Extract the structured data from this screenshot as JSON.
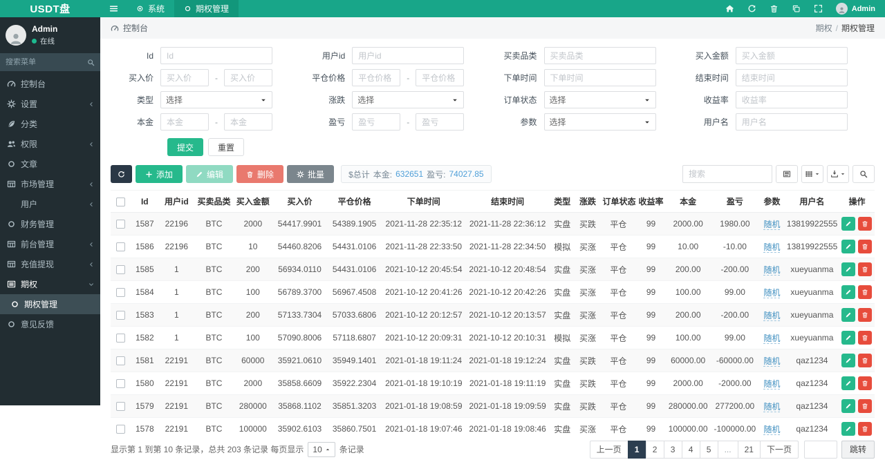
{
  "colors": {
    "accent_green": "#18a689",
    "success_text": "#1db98f",
    "link_blue": "#3f8fc0",
    "danger_red": "#e74c3c",
    "sidebar_bg": "#222d32",
    "pagination_active": "#2c3e50"
  },
  "app": {
    "logo": "USDT盘"
  },
  "topbar": {
    "tabs": [
      {
        "label": "系统"
      },
      {
        "label": "期权管理",
        "active": true
      }
    ],
    "user": "Admin"
  },
  "sidebar": {
    "user": {
      "name": "Admin",
      "status": "在线"
    },
    "search_placeholder": "搜索菜单",
    "items": [
      {
        "id": "dashboard",
        "label": "控制台",
        "icon": "gauge"
      },
      {
        "id": "settings",
        "label": "设置",
        "icon": "gear",
        "arrow": "left"
      },
      {
        "id": "category",
        "label": "分类",
        "icon": "leaf"
      },
      {
        "id": "permission",
        "label": "权限",
        "icon": "users",
        "arrow": "left"
      },
      {
        "id": "article",
        "label": "文章",
        "icon": "circle"
      },
      {
        "id": "market",
        "label": "市场管理",
        "icon": "table",
        "arrow": "left"
      },
      {
        "id": "user",
        "label": "用户",
        "icon": "user",
        "arrow": "left"
      },
      {
        "id": "finance",
        "label": "财务管理",
        "icon": "circle"
      },
      {
        "id": "frontend",
        "label": "前台管理",
        "icon": "table",
        "arrow": "left"
      },
      {
        "id": "recharge",
        "label": "充值提现",
        "icon": "table",
        "arrow": "left"
      },
      {
        "id": "option",
        "label": "期权",
        "icon": "list",
        "arrow": "down",
        "expanded": true
      },
      {
        "id": "option-manage",
        "label": "期权管理",
        "icon": "circle",
        "active": true,
        "submenu": true
      },
      {
        "id": "feedback",
        "label": "意见反馈",
        "icon": "circle"
      }
    ]
  },
  "breadcrumb": {
    "left": "控制台",
    "parent": "期权",
    "separator": "/",
    "current": "期权管理"
  },
  "filters": [
    {
      "label": "Id",
      "type": "text",
      "placeholder": "Id"
    },
    {
      "label": "用户id",
      "type": "text",
      "placeholder": "用户id"
    },
    {
      "label": "买卖品类",
      "type": "text",
      "placeholder": "买卖品类"
    },
    {
      "label": "买入金额",
      "type": "text",
      "placeholder": "买入金额"
    },
    {
      "label": "买入价",
      "type": "range",
      "placeholder": "买入价"
    },
    {
      "label": "平仓价格",
      "type": "range",
      "placeholder": "平仓价格"
    },
    {
      "label": "下单时间",
      "type": "text",
      "placeholder": "下单时间"
    },
    {
      "label": "结束时间",
      "type": "text",
      "placeholder": "结束时间"
    },
    {
      "label": "类型",
      "type": "select",
      "value": "选择"
    },
    {
      "label": "涨跌",
      "type": "select",
      "value": "选择"
    },
    {
      "label": "订单状态",
      "type": "select",
      "value": "选择"
    },
    {
      "label": "收益率",
      "type": "text",
      "placeholder": "收益率"
    },
    {
      "label": "本金",
      "type": "range",
      "placeholder": "本金"
    },
    {
      "label": "盈亏",
      "type": "range",
      "placeholder": "盈亏"
    },
    {
      "label": "参数",
      "type": "select",
      "value": "选择"
    },
    {
      "label": "用户名",
      "type": "text",
      "placeholder": "用户名"
    }
  ],
  "form_buttons": {
    "submit": "提交",
    "reset": "重置"
  },
  "toolbar": {
    "add": "添加",
    "edit": "编辑",
    "delete": "删除",
    "batch": "批量",
    "totals": {
      "prefix": "$总计",
      "principal_label": "本金:",
      "principal": "632651",
      "profit_label": "盈亏:",
      "profit": "74027.85"
    },
    "search_placeholder": "搜索"
  },
  "table": {
    "columns": [
      {
        "key": "",
        "label": "",
        "kind": "check",
        "w": "2.7%"
      },
      {
        "key": "id",
        "label": "Id",
        "w": "3.7%"
      },
      {
        "key": "uid",
        "label": "用户id",
        "w": "4.8%"
      },
      {
        "key": "category",
        "label": "买卖品类",
        "w": "5.2%"
      },
      {
        "key": "amount",
        "label": "买入金额",
        "w": "5.2%"
      },
      {
        "key": "buy_price",
        "label": "买入价",
        "w": "7.3%"
      },
      {
        "key": "close_price",
        "label": "平仓价格",
        "w": "7.3%"
      },
      {
        "key": "order_time",
        "label": "下单时间",
        "w": "11.2%"
      },
      {
        "key": "end_time",
        "label": "结束时间",
        "w": "11.2%"
      },
      {
        "key": "type",
        "label": "类型",
        "kind": "type",
        "w": "3.4%"
      },
      {
        "key": "direction",
        "label": "涨跌",
        "kind": "direction",
        "w": "3.4%"
      },
      {
        "key": "status",
        "label": "订单状态",
        "kind": "green",
        "w": "4.8%"
      },
      {
        "key": "rate",
        "label": "收益率",
        "w": "3.9%"
      },
      {
        "key": "principal",
        "label": "本金",
        "w": "6.0%"
      },
      {
        "key": "profit",
        "label": "盈亏",
        "w": "6.5%"
      },
      {
        "key": "param",
        "label": "参数",
        "kind": "link",
        "w": "3.4%"
      },
      {
        "key": "username",
        "label": "用户名",
        "w": "7.3%"
      },
      {
        "key": "",
        "label": "操作",
        "kind": "actions",
        "w": "4.7%"
      }
    ],
    "rows": [
      {
        "id": "1587",
        "uid": "22196",
        "category": "BTC",
        "amount": "2000",
        "buy_price": "54417.9901",
        "close_price": "54389.1905",
        "order_time": "2021-11-28 22:35:12",
        "end_time": "2021-11-28 22:36:12",
        "type": "实盘",
        "direction": "买跌",
        "status": "平仓",
        "rate": "99",
        "principal": "2000.00",
        "profit": "1980.00",
        "param": "随机",
        "username": "13819922555"
      },
      {
        "id": "1586",
        "uid": "22196",
        "category": "BTC",
        "amount": "10",
        "buy_price": "54460.8206",
        "close_price": "54431.0106",
        "order_time": "2021-11-28 22:33:50",
        "end_time": "2021-11-28 22:34:50",
        "type": "模拟",
        "direction": "买涨",
        "status": "平仓",
        "rate": "99",
        "principal": "10.00",
        "profit": "-10.00",
        "param": "随机",
        "username": "13819922555"
      },
      {
        "id": "1585",
        "uid": "1",
        "category": "BTC",
        "amount": "200",
        "buy_price": "56934.0110",
        "close_price": "54431.0106",
        "order_time": "2021-10-12 20:45:54",
        "end_time": "2021-10-12 20:48:54",
        "type": "实盘",
        "direction": "买涨",
        "status": "平仓",
        "rate": "99",
        "principal": "200.00",
        "profit": "-200.00",
        "param": "随机",
        "username": "xueyuanma"
      },
      {
        "id": "1584",
        "uid": "1",
        "category": "BTC",
        "amount": "100",
        "buy_price": "56789.3700",
        "close_price": "56967.4508",
        "order_time": "2021-10-12 20:41:26",
        "end_time": "2021-10-12 20:42:26",
        "type": "实盘",
        "direction": "买涨",
        "status": "平仓",
        "rate": "99",
        "principal": "100.00",
        "profit": "99.00",
        "param": "随机",
        "username": "xueyuanma"
      },
      {
        "id": "1583",
        "uid": "1",
        "category": "BTC",
        "amount": "200",
        "buy_price": "57133.7304",
        "close_price": "57033.6806",
        "order_time": "2021-10-12 20:12:57",
        "end_time": "2021-10-12 20:13:57",
        "type": "实盘",
        "direction": "买涨",
        "status": "平仓",
        "rate": "99",
        "principal": "200.00",
        "profit": "-200.00",
        "param": "随机",
        "username": "xueyuanma"
      },
      {
        "id": "1582",
        "uid": "1",
        "category": "BTC",
        "amount": "100",
        "buy_price": "57090.8006",
        "close_price": "57118.6807",
        "order_time": "2021-10-12 20:09:31",
        "end_time": "2021-10-12 20:10:31",
        "type": "模拟",
        "direction": "买涨",
        "status": "平仓",
        "rate": "99",
        "principal": "100.00",
        "profit": "99.00",
        "param": "随机",
        "username": "xueyuanma"
      },
      {
        "id": "1581",
        "uid": "22191",
        "category": "BTC",
        "amount": "60000",
        "buy_price": "35921.0610",
        "close_price": "35949.1401",
        "order_time": "2021-01-18 19:11:24",
        "end_time": "2021-01-18 19:12:24",
        "type": "实盘",
        "direction": "买跌",
        "status": "平仓",
        "rate": "99",
        "principal": "60000.00",
        "profit": "-60000.00",
        "param": "随机",
        "username": "qaz1234"
      },
      {
        "id": "1580",
        "uid": "22191",
        "category": "BTC",
        "amount": "2000",
        "buy_price": "35858.6609",
        "close_price": "35922.2304",
        "order_time": "2021-01-18 19:10:19",
        "end_time": "2021-01-18 19:11:19",
        "type": "实盘",
        "direction": "买跌",
        "status": "平仓",
        "rate": "99",
        "principal": "2000.00",
        "profit": "-2000.00",
        "param": "随机",
        "username": "qaz1234"
      },
      {
        "id": "1579",
        "uid": "22191",
        "category": "BTC",
        "amount": "280000",
        "buy_price": "35868.1102",
        "close_price": "35851.3203",
        "order_time": "2021-01-18 19:08:59",
        "end_time": "2021-01-18 19:09:59",
        "type": "实盘",
        "direction": "买跌",
        "status": "平仓",
        "rate": "99",
        "principal": "280000.00",
        "profit": "277200.00",
        "param": "随机",
        "username": "qaz1234"
      },
      {
        "id": "1578",
        "uid": "22191",
        "category": "BTC",
        "amount": "100000",
        "buy_price": "35902.6103",
        "close_price": "35860.7501",
        "order_time": "2021-01-18 19:07:46",
        "end_time": "2021-01-18 19:08:46",
        "type": "实盘",
        "direction": "买涨",
        "status": "平仓",
        "rate": "99",
        "principal": "100000.00",
        "profit": "-100000.00",
        "param": "随机",
        "username": "qaz1234"
      }
    ]
  },
  "footer": {
    "summary_prefix": "显示第 1 到第 10 条记录，总共 203 条记录 每页显示",
    "page_size": "10",
    "summary_suffix": "条记录",
    "pagination": {
      "prev": "上一页",
      "pages": [
        "1",
        "2",
        "3",
        "4",
        "5",
        "...",
        "21"
      ],
      "active": "1",
      "next": "下一页",
      "jump": "跳转"
    }
  }
}
